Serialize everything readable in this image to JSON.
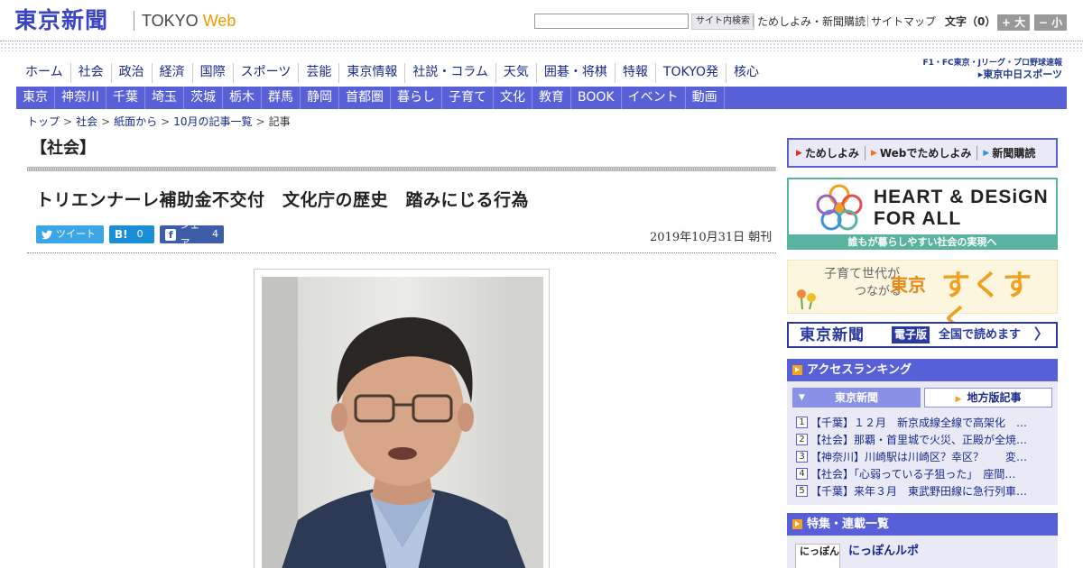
{
  "header": {
    "logo": "東京新聞",
    "logo_sub_prefix": "TOKYO ",
    "logo_sub_web": "Web",
    "search_button": "サイト内検索",
    "top_links": [
      "ためしよみ・新聞購読",
      "サイトマップ"
    ],
    "font_size_label": "文字（0）",
    "font_up": "+ 大",
    "font_down": "− 小"
  },
  "main_nav": [
    "ホーム",
    "社会",
    "政治",
    "経済",
    "国際",
    "スポーツ",
    "芸能",
    "東京情報",
    "社説・コラム",
    "天気",
    "囲碁・将棋",
    "特報",
    "TOKYO発",
    "核心"
  ],
  "chunichi": {
    "line1": "F1・FC東京・Jリーグ・プロ野球速報",
    "line2": "▸東京中日スポーツ"
  },
  "sub_nav": [
    "東京",
    "神奈川",
    "千葉",
    "埼玉",
    "茨城",
    "栃木",
    "群馬",
    "静岡",
    "首都圏",
    "暮らし",
    "子育て",
    "文化",
    "教育",
    "BOOK",
    "イベント",
    "動画"
  ],
  "breadcrumb": [
    "トップ",
    "社会",
    "紙面から",
    "10月の記事一覧"
  ],
  "breadcrumb_current": "記事",
  "article": {
    "section": "【社会】",
    "title": "トリエンナーレ補助金不交付　文化庁の歴史　踏みにじる行為",
    "date": "2019年10月31日 朝刊",
    "share_tweet": "ツイート",
    "share_hatena_label": "B!",
    "share_hatena_count": "0",
    "share_fb_label": "シェア",
    "share_fb_count": "4"
  },
  "sidebar": {
    "tameshi_links": [
      "ためしよみ",
      "Webでためしよみ",
      "新聞購読"
    ],
    "hd_line1": "HEART & DESiGN",
    "hd_line2": "FOR ALL",
    "hd_strip": "誰もが暮らしやすい社会の実現へ",
    "suku_1": "子育て世代が",
    "suku_2": "つながる",
    "suku_3": "東京",
    "suku_4": "すくすく",
    "epaper_logo": "東京新聞",
    "epaper_badge": "電子版",
    "epaper_text": "全国で読めます",
    "ranking_title": "アクセスランキング",
    "ranking_tab_active": "東京新聞",
    "ranking_tab_inactive": "地方版記事",
    "ranking": [
      {
        "num": "1",
        "text": "【千葉】１２月　新京成線全線で高架化　…"
      },
      {
        "num": "2",
        "text": "【社会】那覇・首里城で火災、正殿が全焼…"
      },
      {
        "num": "3",
        "text": "【神奈川】川崎駅は川崎区？幸区？　　変…"
      },
      {
        "num": "4",
        "text": "【社会】「心弱っている子狙った」　座間…"
      },
      {
        "num": "5",
        "text": "【千葉】来年３月　東武野田線に急行列車…"
      }
    ],
    "feature_title": "特集・連載一覧",
    "feature_item_thumb": "にっぽん",
    "feature_item_title": "にっぽんルポ"
  },
  "colors": {
    "brand_blue": "#3b45c4",
    "nav_purple": "#5860d8",
    "hd_teal": "#5ab3a0",
    "accent_orange": "#f5a020"
  }
}
